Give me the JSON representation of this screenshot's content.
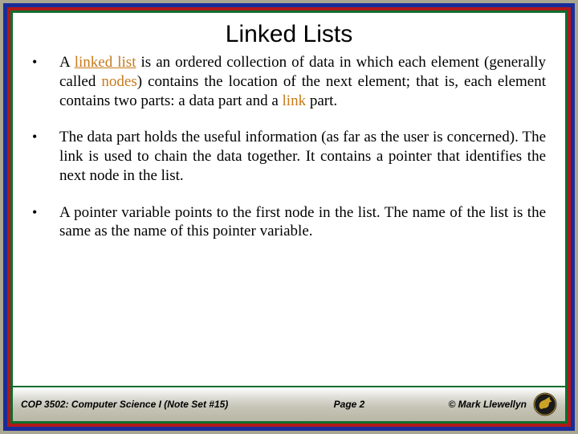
{
  "title": "Linked Lists",
  "bullets": {
    "b1": {
      "pre": "A ",
      "term1": "linked list",
      "mid": " is an ordered collection of data in which each element (generally called ",
      "term2": "nodes",
      "mid2": ") contains the location of the next element; that is, each element contains two parts: a data part and a ",
      "term3": "link",
      "post": " part."
    },
    "b2": "The data part holds the useful information (as far as the user is concerned).  The link is used to chain the data together.  It contains a pointer that identifies the next node in the list.",
    "b3": "A pointer variable points to the first node in the list.  The name of the list is the same as the name of this pointer variable."
  },
  "footer": {
    "left": "COP 3502: Computer Science I  (Note Set #15)",
    "center": "Page 2",
    "right": "© Mark Llewellyn"
  }
}
